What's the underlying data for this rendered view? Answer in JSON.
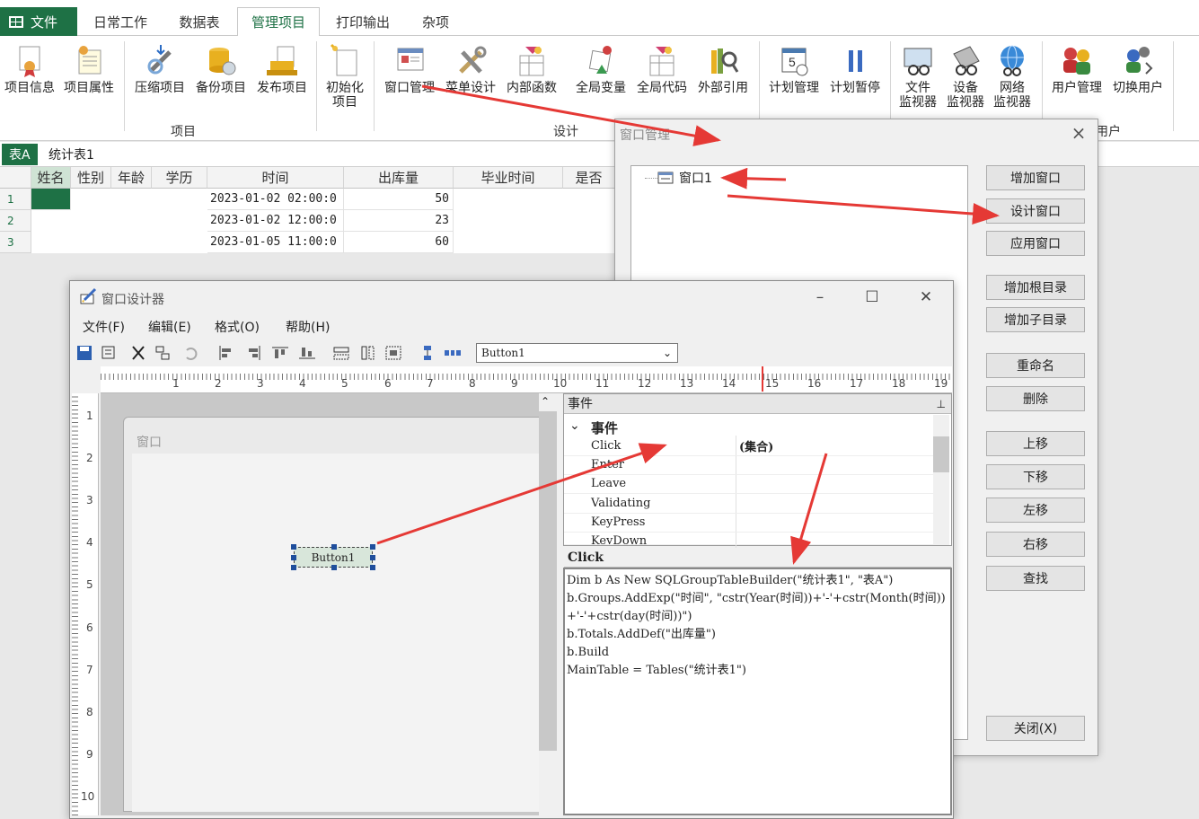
{
  "ribbon": {
    "file_tab": "文件",
    "tabs": [
      "日常工作",
      "数据表",
      "管理项目",
      "打印输出",
      "杂项"
    ],
    "active_tab": "管理项目",
    "buttons": {
      "b0": "项目信息",
      "b1": "项目属性",
      "b2": "压缩项目",
      "b3": "备份项目",
      "b4": "发布项目",
      "b5a": "初始化",
      "b5b": "项目",
      "b6": "窗口管理",
      "b7": "菜单设计",
      "b8": "内部函数",
      "b9": "全局变量",
      "b10": "全局代码",
      "b11": "外部引用",
      "b12": "计划管理",
      "b13": "计划暂停",
      "b14a": "文件",
      "b14b": "监视器",
      "b15a": "设备",
      "b15b": "监视器",
      "b16a": "网络",
      "b16b": "监视器",
      "b17": "用户管理",
      "b18": "切换用户"
    },
    "groups": {
      "project": "项目",
      "design": "设计",
      "user": "用户"
    }
  },
  "sheet": {
    "tabs": [
      "表A",
      "统计表1"
    ],
    "active_tab": "表A",
    "columns": [
      "姓名",
      "性别",
      "年龄",
      "学历",
      "时间",
      "出库量",
      "毕业时间",
      "是否"
    ],
    "rows": [
      {
        "num": "1",
        "time": "2023-01-02 02:00:0",
        "qty": "50"
      },
      {
        "num": "2",
        "time": "2023-01-02 12:00:0",
        "qty": "23"
      },
      {
        "num": "3",
        "time": "2023-01-05 11:00:0",
        "qty": "60"
      }
    ]
  },
  "window_manager": {
    "title": "窗口管理",
    "tree_item": "窗口1",
    "buttons": {
      "add_window": "增加窗口",
      "design_window": "设计窗口",
      "apply_window": "应用窗口",
      "add_root": "增加根目录",
      "add_child": "增加子目录",
      "rename": "重命名",
      "delete": "删除",
      "up": "上移",
      "down": "下移",
      "left": "左移",
      "right": "右移",
      "find": "查找",
      "close": "关闭(X)"
    }
  },
  "designer": {
    "title": "窗口设计器",
    "menus": [
      "文件(F)",
      "编辑(E)",
      "格式(O)",
      "帮助(H)"
    ],
    "selected_control": "Button1",
    "form_title": "窗口",
    "button_label": "Button1",
    "ruler_top": [
      "1",
      "2",
      "3",
      "4",
      "5",
      "6",
      "7",
      "8",
      "9",
      "10",
      "11",
      "12",
      "13",
      "14",
      "15",
      "16",
      "17",
      "18",
      "19"
    ],
    "ruler_left": [
      "1",
      "2",
      "3",
      "4",
      "5",
      "6",
      "7",
      "8",
      "9",
      "10"
    ],
    "events_panel": {
      "header": "事件",
      "category": "事件",
      "rows": [
        {
          "name": "Click",
          "value": "(集合)"
        },
        {
          "name": "Enter",
          "value": ""
        },
        {
          "name": "Leave",
          "value": ""
        },
        {
          "name": "Validating",
          "value": ""
        },
        {
          "name": "KeyPress",
          "value": ""
        },
        {
          "name": "KeyDown",
          "value": ""
        }
      ]
    },
    "code_label": "Click",
    "code": "Dim b As New SQLGroupTableBuilder(\"统计表1\", \"表A\")\nb.Groups.AddExp(\"时间\", \"cstr(Year(时间))+'-'+cstr(Month(时间))+'-'+cstr(day(时间))\")\nb.Totals.AddDef(\"出库量\")\nb.Build\nMainTable = Tables(\"统计表1\")"
  },
  "colors": {
    "accent_green": "#1e7145",
    "arrow_red": "#e53935"
  }
}
